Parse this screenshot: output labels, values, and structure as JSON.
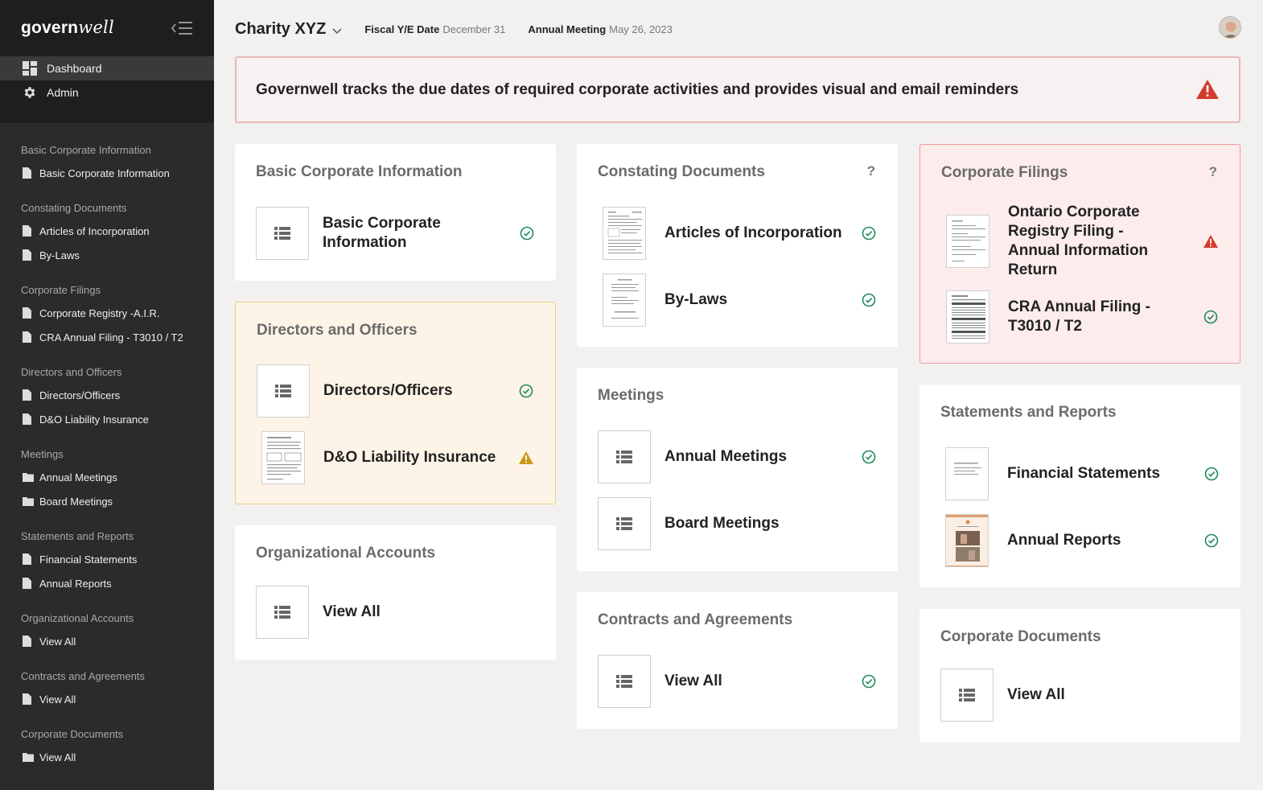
{
  "app": {
    "logo_bold": "govern",
    "logo_italic": "well"
  },
  "sidebar": {
    "nav": [
      {
        "label": "Dashboard",
        "icon": "dashboard-icon"
      },
      {
        "label": "Admin",
        "icon": "gear-icon"
      }
    ],
    "sections": [
      {
        "title": "Basic Corporate Information",
        "items": [
          {
            "label": "Basic Corporate Information",
            "icon": "file-icon"
          }
        ]
      },
      {
        "title": "Constating Documents",
        "items": [
          {
            "label": "Articles of Incorporation",
            "icon": "file-icon"
          },
          {
            "label": "By-Laws",
            "icon": "file-icon"
          }
        ]
      },
      {
        "title": "Corporate Filings",
        "items": [
          {
            "label": "Corporate Registry -A.I.R.",
            "icon": "file-icon"
          },
          {
            "label": "CRA Annual Filing - T3010 / T2",
            "icon": "file-icon"
          }
        ]
      },
      {
        "title": "Directors and Officers",
        "items": [
          {
            "label": "Directors/Officers",
            "icon": "file-icon"
          },
          {
            "label": "D&O Liability Insurance",
            "icon": "file-icon"
          }
        ]
      },
      {
        "title": "Meetings",
        "items": [
          {
            "label": "Annual Meetings",
            "icon": "folder-icon"
          },
          {
            "label": "Board Meetings",
            "icon": "folder-icon"
          }
        ]
      },
      {
        "title": "Statements and Reports",
        "items": [
          {
            "label": "Financial Statements",
            "icon": "file-icon"
          },
          {
            "label": "Annual Reports",
            "icon": "file-icon"
          }
        ]
      },
      {
        "title": "Organizational Accounts",
        "items": [
          {
            "label": "View All",
            "icon": "file-icon"
          }
        ]
      },
      {
        "title": "Contracts and Agreements",
        "items": [
          {
            "label": "View All",
            "icon": "file-icon"
          }
        ]
      },
      {
        "title": "Corporate Documents",
        "items": [
          {
            "label": "View All",
            "icon": "folder-icon"
          }
        ]
      }
    ]
  },
  "header": {
    "org_name": "Charity XYZ",
    "fiscal_label": "Fiscal Y/E Date",
    "fiscal_value": "December 31",
    "meeting_label": "Annual Meeting",
    "meeting_value": "May 26, 2023"
  },
  "banner": {
    "text": "Governwell tracks the due dates of required corporate activities and provides visual and email reminders"
  },
  "colors": {
    "ok": "#1f8a5a",
    "warn": "#c99a12",
    "alert": "#d33b2c"
  },
  "cards": {
    "basic": {
      "title": "Basic Corporate Information",
      "rows": [
        {
          "label": "Basic Corporate Information",
          "status": "ok"
        }
      ]
    },
    "directors": {
      "title": "Directors and Officers",
      "rows": [
        {
          "label": "Directors/Officers",
          "status": "ok"
        },
        {
          "label": "D&O Liability Insurance",
          "status": "warn"
        }
      ]
    },
    "org_accounts": {
      "title": "Organizational Accounts",
      "rows": [
        {
          "label": "View All"
        }
      ]
    },
    "constating": {
      "title": "Constating Documents",
      "help": "?",
      "rows": [
        {
          "label": "Articles of Incorporation",
          "status": "ok"
        },
        {
          "label": "By-Laws",
          "status": "ok"
        }
      ]
    },
    "meetings": {
      "title": "Meetings",
      "rows": [
        {
          "label": "Annual Meetings",
          "status": "ok"
        },
        {
          "label": "Board Meetings"
        }
      ]
    },
    "contracts": {
      "title": "Contracts and Agreements",
      "rows": [
        {
          "label": "View All",
          "status": "ok"
        }
      ]
    },
    "filings": {
      "title": "Corporate Filings",
      "help": "?",
      "rows": [
        {
          "label": "Ontario Corporate Registry Filing - Annual Information Return",
          "status": "alert"
        },
        {
          "label": "CRA Annual Filing - T3010 / T2",
          "status": "ok"
        }
      ]
    },
    "statements": {
      "title": "Statements and Reports",
      "rows": [
        {
          "label": "Financial Statements",
          "status": "ok"
        },
        {
          "label": "Annual Reports",
          "status": "ok"
        }
      ]
    },
    "corp_docs": {
      "title": "Corporate Documents",
      "rows": [
        {
          "label": "View All"
        }
      ]
    }
  }
}
